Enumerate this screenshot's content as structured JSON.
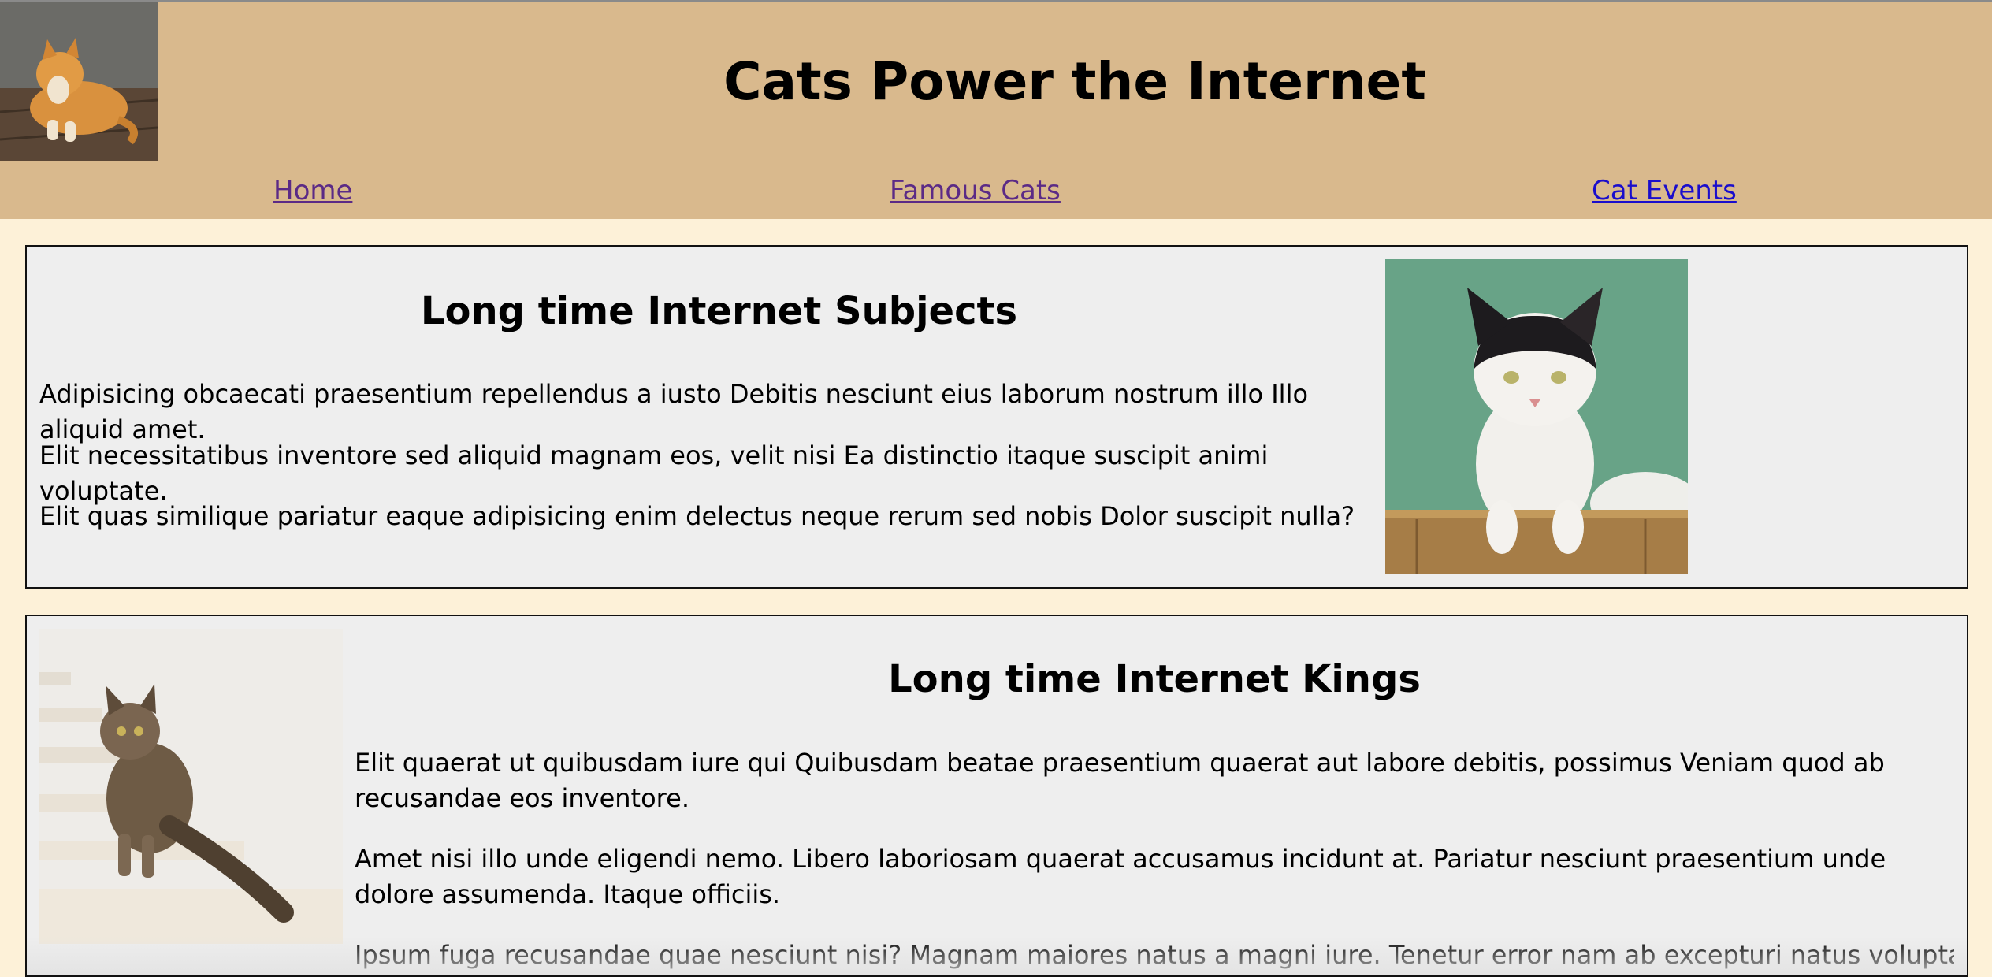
{
  "header": {
    "title": "Cats Power the Internet",
    "logo_icon": "cat-photo-icon"
  },
  "nav": {
    "home": "Home",
    "famous": "Famous Cats",
    "events": "Cat Events"
  },
  "sections": [
    {
      "title": "Long time Internet Subjects",
      "paragraphs": [
        "Adipisicing obcaecati praesentium repellendus a iusto Debitis nesciunt eius laborum nostrum illo Illo aliquid amet.",
        "Elit necessitatibus inventore sed aliquid magnam eos, velit nisi Ea distinctio itaque suscipit animi voluptate.",
        "Elit quas similique pariatur eaque adipisicing enim delectus neque rerum sed nobis Dolor suscipit nulla?"
      ]
    },
    {
      "title": "Long time Internet Kings",
      "paragraphs": [
        "Elit quaerat ut quibusdam iure qui Quibusdam beatae praesentium quaerat aut labore debitis, possimus Veniam quod ab recusandae eos inventore.",
        "Amet nisi illo unde eligendi nemo. Libero laboriosam quaerat accusamus incidunt at. Pariatur nesciunt praesentium unde dolore assumenda. Itaque officiis.",
        "Ipsum fuga recusandae quae nesciunt nisi? Magnam maiores natus a magni iure. Tenetur error nam ab excepturi natus voluptatibus"
      ]
    }
  ],
  "colors": {
    "header_bg": "#d9b98d",
    "page_bg": "#fdf1d8",
    "card_bg": "#eeeeee",
    "visited_link": "#5b2a86",
    "link": "#1a0dcc"
  }
}
